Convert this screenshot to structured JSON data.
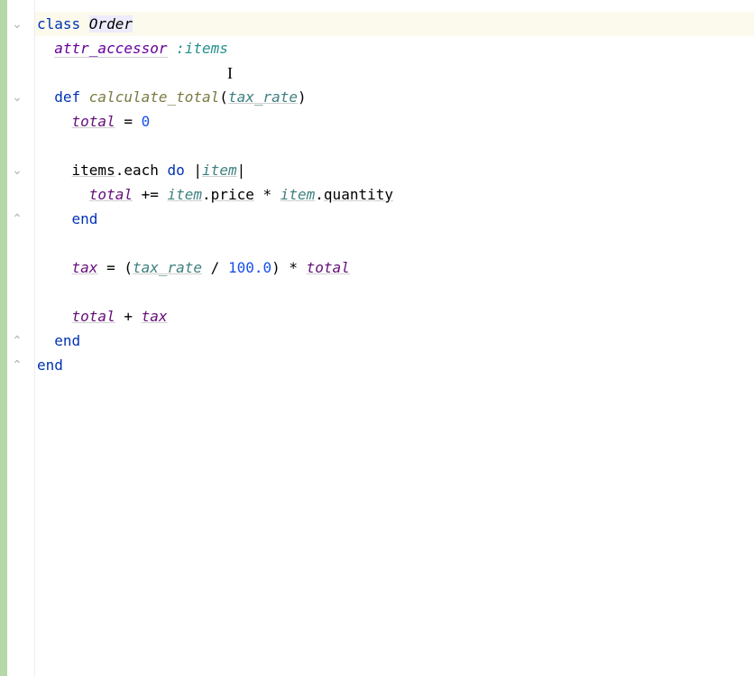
{
  "fold_marks": {
    "m0": "⌄",
    "m1": "⌄",
    "m2": "⌄",
    "m3": "⌃",
    "m4": "⌃",
    "m5": "⌃"
  },
  "code": {
    "l0": {
      "kw": "class ",
      "cls": "Order"
    },
    "l1": {
      "indent": "  ",
      "attr": "attr_accessor",
      "sp": " ",
      "sym": ":items"
    },
    "l2": {
      "indent": ""
    },
    "l3": {
      "indent": "  ",
      "kw": "def ",
      "name": "calculate_total",
      "open": "(",
      "param": "tax_rate",
      "close": ")"
    },
    "l4": {
      "indent": "    ",
      "var": "total",
      "op": " = ",
      "num": "0"
    },
    "l5": {
      "indent": ""
    },
    "l6": {
      "indent": "    ",
      "recv": "items",
      "dot": ".",
      "each": "each",
      "sp": " ",
      "do": "do",
      "bar1": " |",
      "bv": "item",
      "bar2": "|"
    },
    "l7": {
      "indent": "      ",
      "var": "total",
      "op": " += ",
      "it1": "item",
      "d1": ".",
      "p": "price",
      "star": " * ",
      "it2": "item",
      "d2": ".",
      "q": "quantity"
    },
    "l8": {
      "indent": "    ",
      "end": "end"
    },
    "l9": {
      "indent": ""
    },
    "l10": {
      "indent": "    ",
      "var": "tax",
      "eq": " = (",
      "tr": "tax_rate",
      "div": " / ",
      "num": "100.0",
      "cp": ") * ",
      "tot": "total"
    },
    "l11": {
      "indent": ""
    },
    "l12": {
      "indent": "    ",
      "t1": "total",
      "plus": " + ",
      "t2": "tax"
    },
    "l13": {
      "indent": "  ",
      "end": "end"
    },
    "l14": {
      "indent": "",
      "end": "end"
    }
  },
  "cursor_glyph": "I"
}
